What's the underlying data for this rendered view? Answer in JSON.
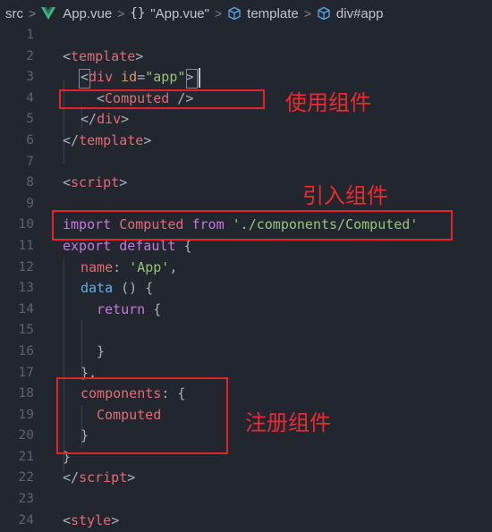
{
  "breadcrumb": {
    "items": [
      "src",
      "App.vue",
      "\"App.vue\"",
      "template",
      "div#app"
    ],
    "braces": "{}",
    "separator": ">"
  },
  "lines": [
    {
      "n": "1"
    },
    {
      "n": "2"
    },
    {
      "n": "3"
    },
    {
      "n": "4"
    },
    {
      "n": "5"
    },
    {
      "n": "6"
    },
    {
      "n": "7"
    },
    {
      "n": "8"
    },
    {
      "n": "9"
    },
    {
      "n": "10"
    },
    {
      "n": "11"
    },
    {
      "n": "12"
    },
    {
      "n": "13"
    },
    {
      "n": "14"
    },
    {
      "n": "15"
    },
    {
      "n": "16"
    },
    {
      "n": "17"
    },
    {
      "n": "18"
    },
    {
      "n": "19"
    },
    {
      "n": "20"
    },
    {
      "n": "21"
    },
    {
      "n": "22"
    },
    {
      "n": "23"
    },
    {
      "n": "24"
    }
  ],
  "code": {
    "l2_open": "<",
    "l2_tag": "template",
    "l2_close": ">",
    "l3_open": "<",
    "l3_tag": "div",
    "l3_attr": "id",
    "l3_eq": "=",
    "l3_val": "\"app\"",
    "l3_close": ">",
    "l4_open": "<",
    "l4_tag": "Computed",
    "l4_close": " />",
    "l5_open": "</",
    "l5_tag": "div",
    "l5_close": ">",
    "l6_open": "</",
    "l6_tag": "template",
    "l6_close": ">",
    "l8_open": "<",
    "l8_tag": "script",
    "l8_close": ">",
    "l10_kw": "import",
    "l10_name": "Computed",
    "l10_from": "from",
    "l10_path": "'./components/Computed'",
    "l11_kw": "export",
    "l11_kw2": "default",
    "l11_brace": "{",
    "l12_prop": "name",
    "l12_colon": ": ",
    "l12_val": "'App'",
    "l12_comma": ",",
    "l13_fn": "data",
    "l13_rest": " () {",
    "l14_kw": "return",
    "l14_brace": " {",
    "l16_brace": "}",
    "l17_brace": "},",
    "l18_prop": "components",
    "l18_rest": ": {",
    "l19_name": "Computed",
    "l20_brace": "}",
    "l21_brace": "}",
    "l22_open": "</",
    "l22_tag": "script",
    "l22_close": ">",
    "l24_open": "<",
    "l24_tag": "style",
    "l24_close": ">"
  },
  "annotations": {
    "use": "使用组件",
    "import": "引入组件",
    "register": "注册组件"
  },
  "colors": {
    "highlight_box": "#e0242a",
    "annotation_text": "#ef2a2f",
    "background": "#22262e"
  }
}
